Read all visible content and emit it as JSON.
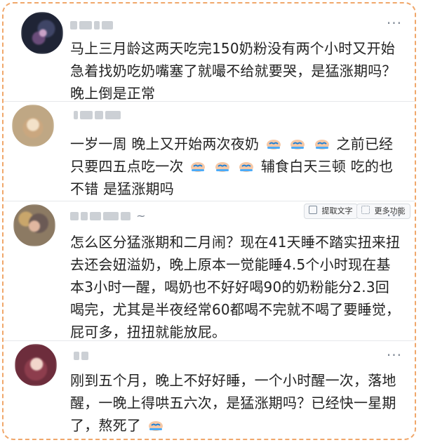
{
  "posts": [
    {
      "name": "post-1",
      "text": "马上三月龄这两天吃完150奶粉没有两个小时又开始急着找奶吃奶嘴塞了就嘬不给就要哭，是猛涨期吗？晚上倒是正常",
      "more": "···"
    },
    {
      "name": "post-2",
      "text_line1_a": "一岁一周 晚上又开始两次夜奶",
      "text_line1_b": "之前已经",
      "text_line2_a": "只要四五点吃一次",
      "text_line2_b": "辅食白天三顿 吃的也",
      "text_line3": "不错 是猛涨期吗",
      "more": "···",
      "buttons": {
        "extract_text": "提取文字",
        "more_functions": "更多功能"
      }
    },
    {
      "name": "post-3",
      "username_suffix": "~",
      "text": "怎么区分猛涨期和二月闹？现在41天睡不踏实扭来扭去还会妞溢奶，晚上原本一觉能睡4.5个小时现在基本3小时一醒，喝奶也不好好喝90的奶粉能分2.3回喝完，尤其是半夜经常60都喝不完就不喝了要睡觉，屁可多，扭扭就能放屁。",
      "more": "···"
    },
    {
      "name": "post-4",
      "text_a": "刚到五个月，晚上不好好睡，一个小时醒一次，落地醒，一晚上得哄五六次，是猛涨期吗？已经快一星期了，熬死了",
      "more": "···"
    }
  ],
  "colors": {
    "border": "#f0a76b",
    "text": "#222222",
    "muted": "#7e8794"
  },
  "icons": [
    "more-dots-icon",
    "crying-face-emoji",
    "extract-text-icon",
    "more-functions-icon"
  ]
}
